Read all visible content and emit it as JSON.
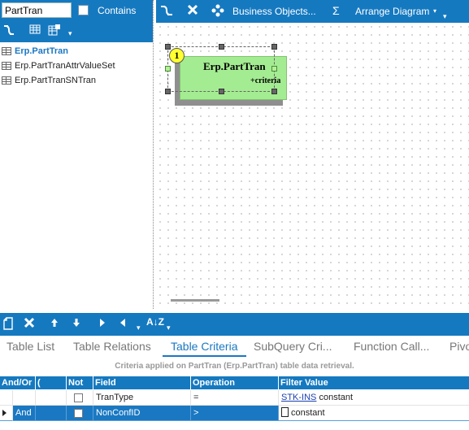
{
  "left": {
    "search_value": "PartTran",
    "contains_label": "Contains",
    "tree": [
      {
        "label": "Erp.PartTran",
        "selected": true
      },
      {
        "label": "Erp.PartTranAttrValueSet",
        "selected": false
      },
      {
        "label": "Erp.PartTranSNTran",
        "selected": false
      }
    ]
  },
  "diagram": {
    "toolbar": {
      "business_objects": "Business Objects...",
      "sigma": "Σ",
      "arrange": "Arrange Diagram"
    },
    "entity": {
      "number": "1",
      "title": "Erp.PartTran",
      "sub": "+criteria",
      "fill_color": "#a4ec92"
    }
  },
  "bottom": {
    "tabs": [
      {
        "label": "Table List",
        "active": false
      },
      {
        "label": "Table Relations",
        "active": false
      },
      {
        "label": "Table Criteria",
        "active": true
      },
      {
        "label": "SubQuery Cri...",
        "active": false
      },
      {
        "label": "Function Call...",
        "active": false
      },
      {
        "label": "Pivo",
        "active": false
      }
    ],
    "criteria_info": "Criteria applied on PartTran (Erp.PartTran)  table data retrieval.",
    "columns": [
      "And/Or",
      "(",
      "Not",
      "Field",
      "Operation",
      "Filter Value"
    ],
    "rows": [
      {
        "andor": "",
        "paren": "",
        "not": false,
        "field": "TranType",
        "operation": "=",
        "filter_link": "STK-INS",
        "filter_type": "constant",
        "selected": false
      },
      {
        "andor": "And",
        "paren": "",
        "not": false,
        "field": "NonConfID",
        "operation": ">",
        "filter_link": "",
        "filter_type": "constant",
        "selected": true
      }
    ]
  },
  "colors": {
    "accent": "#1579c0",
    "active_tab": "#1a78c2",
    "entity_green": "#a4ec92",
    "badge_yellow": "#ffff30"
  }
}
